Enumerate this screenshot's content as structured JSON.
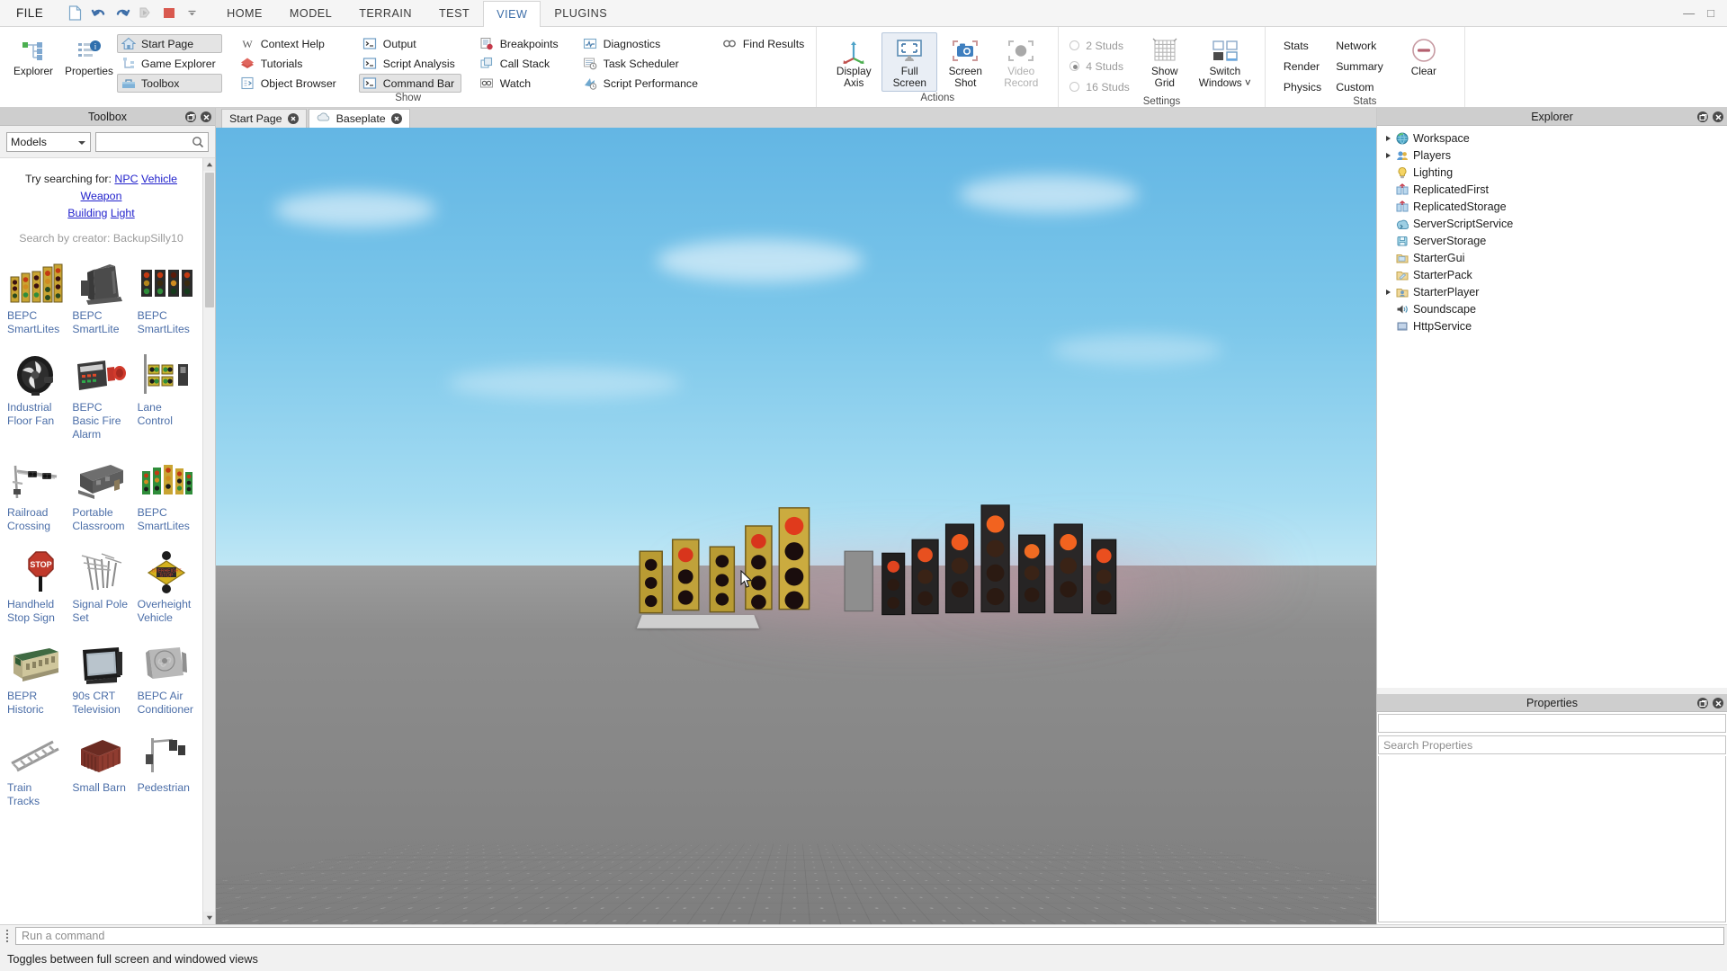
{
  "menubar": {
    "file_label": "FILE",
    "quick_actions": [
      {
        "name": "new-document-icon",
        "label": "New"
      },
      {
        "name": "undo-icon",
        "label": "Undo"
      },
      {
        "name": "redo-icon",
        "label": "Redo"
      },
      {
        "name": "play-icon",
        "label": "Play"
      },
      {
        "name": "stop-icon",
        "label": "Stop"
      },
      {
        "name": "chevron-down-icon",
        "label": "More"
      }
    ],
    "tabs": [
      {
        "label": "HOME",
        "active": false
      },
      {
        "label": "MODEL",
        "active": false
      },
      {
        "label": "TERRAIN",
        "active": false
      },
      {
        "label": "TEST",
        "active": false
      },
      {
        "label": "VIEW",
        "active": true
      },
      {
        "label": "PLUGINS",
        "active": false
      }
    ],
    "window_controls": [
      "—",
      "□"
    ]
  },
  "ribbon": {
    "groups": [
      {
        "title": "Show",
        "large_buttons": [
          {
            "label1": "Explorer",
            "label2": "",
            "icon": "explorer-tree-icon",
            "selected": false
          },
          {
            "label1": "Properties",
            "label2": "",
            "icon": "properties-list-icon",
            "selected": false
          }
        ],
        "columns": [
          [
            {
              "label": "Start Page",
              "icon": "home-icon",
              "selected": true
            },
            {
              "label": "Game Explorer",
              "icon": "game-explorer-icon",
              "selected": false
            },
            {
              "label": "Toolbox",
              "icon": "toolbox-icon",
              "selected": true
            }
          ],
          [
            {
              "label": "Context Help",
              "icon": "context-help-icon",
              "selected": false
            },
            {
              "label": "Tutorials",
              "icon": "tutorials-icon",
              "selected": false
            },
            {
              "label": "Object Browser",
              "icon": "object-browser-icon",
              "selected": false
            }
          ],
          [
            {
              "label": "Output",
              "icon": "output-console-icon",
              "selected": false
            },
            {
              "label": "Script Analysis",
              "icon": "script-analysis-icon",
              "selected": false
            },
            {
              "label": "Command Bar",
              "icon": "command-bar-icon",
              "selected": true
            }
          ],
          [
            {
              "label": "Breakpoints",
              "icon": "breakpoints-icon",
              "selected": false
            },
            {
              "label": "Call Stack",
              "icon": "call-stack-icon",
              "selected": false
            },
            {
              "label": "Watch",
              "icon": "watch-icon",
              "selected": false
            }
          ],
          [
            {
              "label": "Diagnostics",
              "icon": "diagnostics-icon",
              "selected": false
            },
            {
              "label": "Task Scheduler",
              "icon": "task-scheduler-icon",
              "selected": false
            },
            {
              "label": "Script Performance",
              "icon": "script-performance-icon",
              "selected": false
            }
          ],
          [
            {
              "label": "Find Results",
              "icon": "find-results-icon",
              "selected": false
            }
          ]
        ]
      },
      {
        "title": "Actions",
        "large_buttons": [
          {
            "label1": "Display",
            "label2": "Axis",
            "icon": "display-axis-icon",
            "selected": false,
            "disabled": false
          },
          {
            "label1": "Full",
            "label2": "Screen",
            "icon": "full-screen-icon",
            "selected": true,
            "disabled": false
          },
          {
            "label1": "Screen",
            "label2": "Shot",
            "icon": "screen-shot-icon",
            "selected": false,
            "disabled": false
          },
          {
            "label1": "Video",
            "label2": "Record",
            "icon": "video-record-icon",
            "selected": false,
            "disabled": true
          }
        ]
      },
      {
        "title": "Settings",
        "radios": [
          {
            "label": "2 Studs",
            "checked": false
          },
          {
            "label": "4 Studs",
            "checked": true
          },
          {
            "label": "16 Studs",
            "checked": false
          }
        ],
        "large_buttons": [
          {
            "label1": "Show",
            "label2": "Grid",
            "icon": "show-grid-icon",
            "selected": false
          },
          {
            "label1": "Switch",
            "label2": "Windows ˅",
            "icon": "switch-windows-icon",
            "selected": false
          }
        ]
      },
      {
        "title": "Stats",
        "stat_links": [
          [
            "Stats",
            "Network"
          ],
          [
            "Render",
            "Summary"
          ],
          [
            "Physics",
            "Custom"
          ]
        ],
        "clear_label": "Clear",
        "clear_icon": "clear-minus-icon"
      }
    ]
  },
  "toolbox": {
    "title": "Toolbox",
    "header_buttons": [
      {
        "name": "undock-icon"
      },
      {
        "name": "close-icon"
      }
    ],
    "category_value": "Models",
    "search_value": "",
    "search_placeholder": "",
    "hint_prefix": "Try searching for:",
    "hint_links": [
      "NPC",
      "Vehicle",
      "Weapon",
      "Building",
      "Light"
    ],
    "creator_text": "Search by creator: BackupSilly10",
    "items": [
      {
        "label": "BEPC SmartLites",
        "thumb": "traffic-signal-row"
      },
      {
        "label": "BEPC SmartLite",
        "thumb": "controller-cabinet"
      },
      {
        "label": "BEPC SmartLites",
        "thumb": "traffic-signal-dark-row"
      },
      {
        "label": "Industrial Floor Fan",
        "thumb": "floor-fan"
      },
      {
        "label": "BEPC Basic Fire Alarm",
        "thumb": "fire-alarm-panel"
      },
      {
        "label": "Lane Control",
        "thumb": "lane-control-signals"
      },
      {
        "label": "Railroad Crossing",
        "thumb": "railroad-crossing"
      },
      {
        "label": "Portable Classroom",
        "thumb": "portable-classroom"
      },
      {
        "label": "BEPC SmartLites",
        "thumb": "traffic-signal-green-row"
      },
      {
        "label": "Handheld Stop Sign",
        "thumb": "handheld-stop-sign"
      },
      {
        "label": "Signal Pole Set",
        "thumb": "signal-pole-set"
      },
      {
        "label": "Overheight Vehicle",
        "thumb": "overheight-vehicle-sign"
      },
      {
        "label": "BEPR Historic",
        "thumb": "historic-building"
      },
      {
        "label": "90s CRT Television",
        "thumb": "crt-television"
      },
      {
        "label": "BEPC Air Conditioner",
        "thumb": "air-conditioner"
      },
      {
        "label": "Train Tracks",
        "thumb": "train-tracks"
      },
      {
        "label": "Small Barn",
        "thumb": "small-barn"
      },
      {
        "label": "Pedestrian",
        "thumb": "pedestrian-signal"
      }
    ]
  },
  "viewport": {
    "tabs": [
      {
        "label": "Start Page",
        "active": false,
        "icon": ""
      },
      {
        "label": "Baseplate",
        "active": true,
        "icon": "cloud-icon"
      }
    ]
  },
  "explorer": {
    "title": "Explorer",
    "header_buttons": [
      {
        "name": "undock-icon"
      },
      {
        "name": "close-icon"
      }
    ],
    "items": [
      {
        "label": "Workspace",
        "icon": "workspace-globe-icon",
        "expandable": true,
        "indent": 0
      },
      {
        "label": "Players",
        "icon": "players-icon",
        "expandable": true,
        "indent": 0
      },
      {
        "label": "Lighting",
        "icon": "lighting-bulb-icon",
        "expandable": false,
        "indent": 0
      },
      {
        "label": "ReplicatedFirst",
        "icon": "replicated-first-icon",
        "expandable": false,
        "indent": 0
      },
      {
        "label": "ReplicatedStorage",
        "icon": "replicated-storage-icon",
        "expandable": false,
        "indent": 0
      },
      {
        "label": "ServerScriptService",
        "icon": "server-script-service-icon",
        "expandable": false,
        "indent": 0
      },
      {
        "label": "ServerStorage",
        "icon": "server-storage-icon",
        "expandable": false,
        "indent": 0
      },
      {
        "label": "StarterGui",
        "icon": "starter-gui-icon",
        "expandable": false,
        "indent": 0
      },
      {
        "label": "StarterPack",
        "icon": "starter-pack-icon",
        "expandable": false,
        "indent": 0
      },
      {
        "label": "StarterPlayer",
        "icon": "starter-player-icon",
        "expandable": true,
        "indent": 0
      },
      {
        "label": "Soundscape",
        "icon": "soundscape-speaker-icon",
        "expandable": false,
        "indent": 0
      },
      {
        "label": "HttpService",
        "icon": "http-service-icon",
        "expandable": false,
        "indent": 0
      }
    ]
  },
  "properties": {
    "title": "Properties",
    "header_buttons": [
      {
        "name": "undock-icon"
      },
      {
        "name": "close-icon"
      }
    ],
    "selected_value": "",
    "search_placeholder": "Search Properties"
  },
  "commandbar": {
    "placeholder": "Run a command",
    "value": ""
  },
  "statusbar": {
    "text": "Toggles between full screen and windowed views"
  },
  "colors": {
    "accent": "#3d6ea8",
    "link": "#2222cc",
    "toolbox_label": "#4b6ea8",
    "selected_bg": "#e9eef5",
    "panel_header": "#cecece",
    "sky_top": "#63b6e4",
    "ground": "#8d8d8d"
  }
}
